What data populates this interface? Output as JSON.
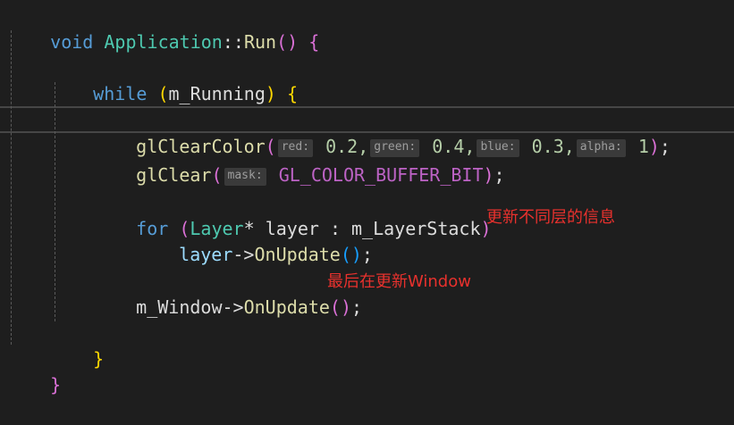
{
  "code": {
    "l1": {
      "kw": "void",
      "cls": "Application",
      "sep": "::",
      "fn": "Run",
      "args": "()",
      "brace": "{"
    },
    "l2": {
      "kw": "while",
      "open": "(",
      "var": "m_Running",
      "close": ")",
      "brace": "{"
    },
    "l3": {
      "fn": "glClearColor",
      "open": "(",
      "h1": "red:",
      "v1": "0.2,",
      "h2": "green:",
      "v2": "0.4,",
      "h3": "blue:",
      "v3": "0.3,",
      "h4": "alpha:",
      "v4": "1",
      "close": ")",
      "semi": ";"
    },
    "l4": {
      "fn": "glClear",
      "open": "(",
      "h1": "mask:",
      "macro": "GL_COLOR_BUFFER_BIT",
      "close": ")",
      "semi": ";"
    },
    "l5": {
      "kw": "for",
      "open": "(",
      "type": "Layer",
      "rest": "* layer : m_LayerStack",
      "close": ")"
    },
    "l6": {
      "var": "layer",
      "arrow": "->",
      "fn": "OnUpdate",
      "args": "()",
      "semi": ";"
    },
    "l7": {
      "var": "m_Window",
      "arrow": "->",
      "fn": "OnUpdate",
      "args": "()",
      "semi": ";"
    },
    "l8": {
      "brace": "}"
    },
    "l9": {
      "brace": "}"
    }
  },
  "annotations": {
    "update_layers": "更新不同层的信息",
    "update_window": "最后在更新Window"
  },
  "colors": {
    "background": "#1e1e1e",
    "keyword": "#569cd6",
    "type": "#4ec9b0",
    "function": "#dcdcaa",
    "annotation": "#e8312d"
  }
}
